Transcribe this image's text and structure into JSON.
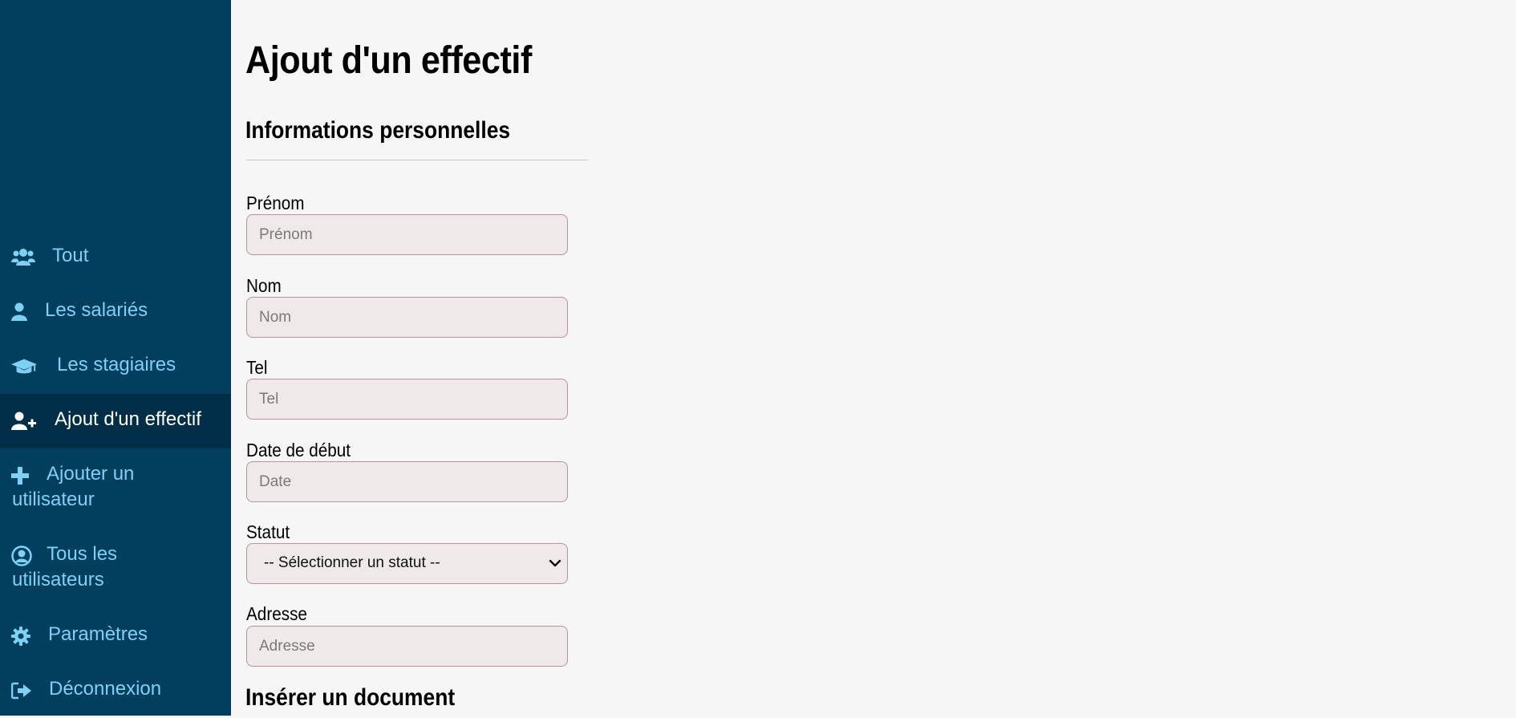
{
  "sidebar": {
    "items": [
      {
        "label": "Tout",
        "icon": "users-icon"
      },
      {
        "label": "Les salariés",
        "icon": "user-icon"
      },
      {
        "label": "Les stagiaires",
        "icon": "graduation-cap-icon"
      },
      {
        "label": "Ajout d'un effectif",
        "icon": "user-plus-icon",
        "active": true
      },
      {
        "label": "Ajouter un utilisateur",
        "icon": "plus-icon"
      },
      {
        "label": "Tous les utilisateurs",
        "icon": "user-circle-icon"
      },
      {
        "label": "Paramètres",
        "icon": "gear-icon"
      },
      {
        "label": "Déconnexion",
        "icon": "sign-out-icon"
      }
    ]
  },
  "main": {
    "title": "Ajout d'un effectif",
    "section_title": "Informations personnelles",
    "fields": {
      "prenom": {
        "label": "Prénom",
        "placeholder": "Prénom",
        "value": ""
      },
      "nom": {
        "label": "Nom",
        "placeholder": "Nom",
        "value": ""
      },
      "tel": {
        "label": "Tel",
        "placeholder": "Tel",
        "value": ""
      },
      "date_debut": {
        "label": "Date de début",
        "placeholder": "Date",
        "value": ""
      },
      "statut": {
        "label": "Statut",
        "selected": "-- Sélectionner un statut --"
      },
      "adresse": {
        "label": "Adresse",
        "placeholder": "Adresse",
        "value": ""
      }
    },
    "document_section_title": "Insérer un document"
  },
  "colors": {
    "sidebar_bg": "#023f5f",
    "sidebar_active_bg": "#012e47",
    "sidebar_text": "#7fd0f5",
    "page_bg": "#f6f6f6",
    "field_bg": "#efe9ea",
    "field_border": "#b8929e"
  }
}
